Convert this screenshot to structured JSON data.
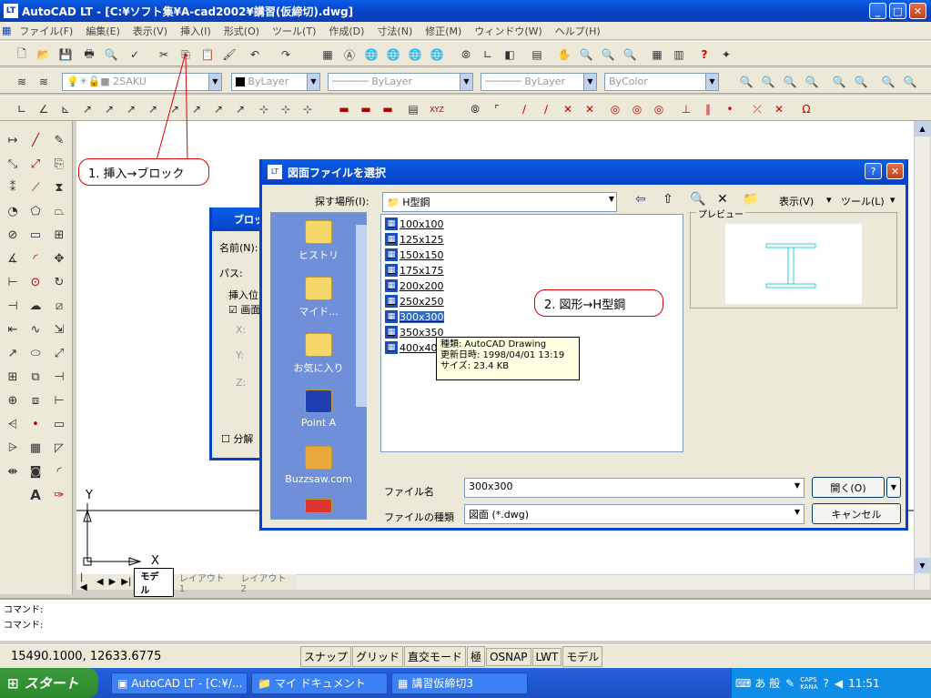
{
  "window": {
    "title": "AutoCAD LT - [C:¥ソフト集¥A-cad2002¥講習(仮締切).dwg]",
    "minimize": "_",
    "maximize": "□",
    "close": "✕"
  },
  "menu": [
    "ファイル(F)",
    "編集(E)",
    "表示(V)",
    "挿入(I)",
    "形式(O)",
    "ツール(T)",
    "作成(D)",
    "寸法(N)",
    "修正(M)",
    "ウィンドウ(W)",
    "ヘルプ(H)"
  ],
  "layers": {
    "layer": "2SAKU",
    "color": "ByLayer",
    "linetype": "ByLayer",
    "lineweight": "ByLayer",
    "plotstyle": "ByColor"
  },
  "annotations": {
    "callout1": "1. 挿入→ブロック",
    "callout2": "2. 図形→H型鋼"
  },
  "canvas": {
    "y_label": "Y",
    "x_label": "X"
  },
  "model_tabs": [
    "モデル",
    "レイアウト1",
    "レイアウト2"
  ],
  "command": {
    "line1": "コマンド:",
    "line2": "コマンド:"
  },
  "status": {
    "coords": "15490.1000, 12633.6775",
    "buttons": [
      "スナップ",
      "グリッド",
      "直交モード",
      "極",
      "OSNAP",
      "LWT",
      "モデル"
    ]
  },
  "taskbar": {
    "start": "スタート",
    "tasks": [
      "AutoCAD LT - [C:¥/...",
      "マイ ドキュメント",
      "講習仮締切3"
    ],
    "tray": {
      "caps": "CAPS",
      "kana": "KANA",
      "time": "11:51",
      "ime": "あ 般"
    }
  },
  "block_dialog": {
    "title": "ブロック",
    "name_label": "名前(N):",
    "path_label": "パス:",
    "insert_label": "挿入位",
    "screen_label": "画面",
    "x": "X:",
    "y": "Y:",
    "z": "Z:",
    "explode": "分解"
  },
  "dialog": {
    "title": "図面ファイルを選択",
    "look_in_label": "探す場所(I):",
    "look_in_value": "H型鋼",
    "view_label": "表示(V)",
    "tools_label": "ツール(L)",
    "preview_label": "プレビュー",
    "places": [
      "ヒストリ",
      "マイド...",
      "お気に入り",
      "Point A",
      "Buzzsaw.com"
    ],
    "files": [
      "100x100",
      "125x125",
      "150x150",
      "175x175",
      "200x200",
      "250x250",
      "300x300",
      "350x350",
      "400x400"
    ],
    "selected_file": "300x300",
    "tooltip": {
      "type": "種類: AutoCAD Drawing",
      "date": "更新日時: 1998/04/01 13:19",
      "size": "サイズ: 23.4 KB"
    },
    "filename_label": "ファイル名",
    "filename_value": "300x300",
    "filetype_label": "ファイルの種類",
    "filetype_value": "図面 (*.dwg)",
    "open_button": "開く(O)",
    "cancel_button": "キャンセル"
  }
}
